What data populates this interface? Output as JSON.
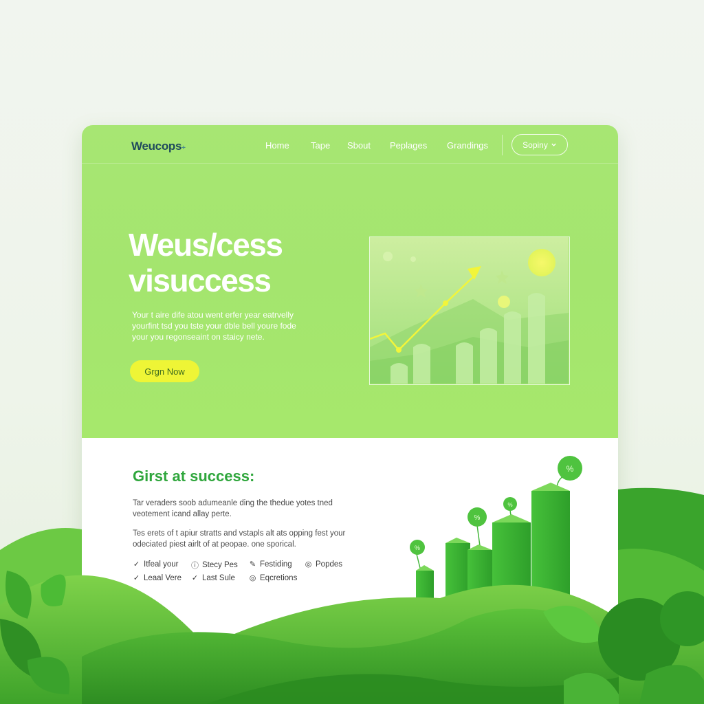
{
  "brand": {
    "logo": "Weucops",
    "logo_mark": "+"
  },
  "nav": {
    "links": [
      "Home",
      "Tape",
      "Sbout",
      "Peplages",
      "Grandings"
    ],
    "button": "Sopiny",
    "button_icon": "chevron-down-icon"
  },
  "hero": {
    "title_line1": "Weus/cess",
    "title_line2": "visuccess",
    "desc_lines": [
      "Your t aire dife atou went erfer year eatrvelly",
      "yourfint tsd you tste your dble bell youre fode",
      "your you regonseaint on staicy nete."
    ],
    "cta": "Grgn Now"
  },
  "section": {
    "title": "Girst at success:",
    "para1": [
      "Tar veraders soob adumeanle ding the thedue yotes tned",
      "veotement icand allay perte."
    ],
    "para2": [
      "Tes erets of t apiur stratts and vstapls alt ats opping fest your",
      "odeciated piest airlt of at peopae. one sporical."
    ],
    "features": [
      {
        "icon": "check-icon",
        "label": "Itfeal your"
      },
      {
        "icon": "info-icon",
        "label": "Stecy Pes"
      },
      {
        "icon": "pencil-icon",
        "label": "Festiding"
      },
      {
        "icon": "target-icon",
        "label": "Popdes"
      },
      {
        "icon": "check-icon",
        "label": "Leaal Vere"
      },
      {
        "icon": "check-icon",
        "label": "Last Sule"
      },
      {
        "icon": "target-icon",
        "label": "Eqcretions"
      }
    ],
    "bubble_labels": [
      "%",
      "%",
      "%",
      "%"
    ]
  },
  "colors": {
    "hero_green": "#a6e66e",
    "accent_yellow": "#eef536",
    "title_green": "#2fa63c",
    "logo_navy": "#1f4a5c"
  }
}
